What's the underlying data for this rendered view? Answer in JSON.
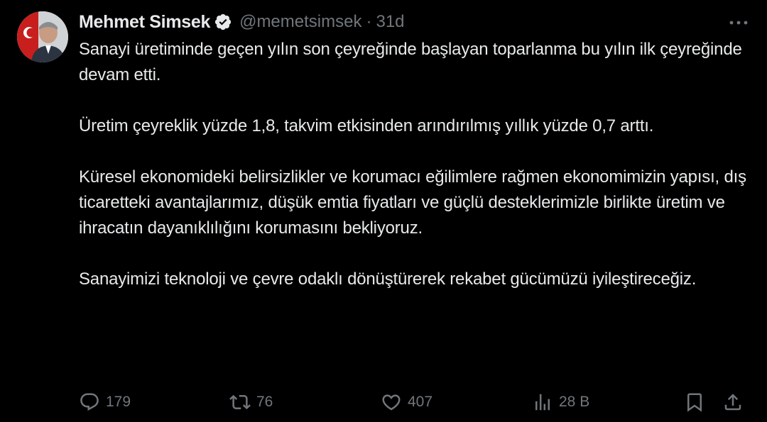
{
  "author": {
    "display_name": "Mehmet Simsek",
    "handle": "@memetsimsek",
    "separator": "·",
    "time": "31d",
    "verified": true
  },
  "body": {
    "paragraphs": [
      "Sanayi üretiminde geçen yılın son çeyreğinde başlayan toparlanma bu yılın ilk çeyreğinde devam etti.",
      "Üretim çeyreklik yüzde 1,8, takvim etkisinden arındırılmış yıllık yüzde 0,7 arttı.",
      "Küresel ekonomideki belirsizlikler ve korumacı eğilimlere rağmen ekonomimizin yapısı, dış ticaretteki avantajlarımız, düşük emtia fiyatları ve güçlü desteklerimizle birlikte üretim ve ihracatın dayanıklılığını korumasını bekliyoruz.",
      "Sanayimizi teknoloji ve çevre odaklı dönüştürerek rekabet gücümüzü iyileştireceğiz."
    ]
  },
  "actions": {
    "replies": "179",
    "reposts": "76",
    "likes": "407",
    "views": "28 B"
  },
  "icons": {
    "more": "more-horizontal-icon",
    "verified": "verified-badge-icon",
    "reply": "reply-icon",
    "repost": "repost-icon",
    "like": "heart-icon",
    "views": "views-icon",
    "bookmark": "bookmark-icon",
    "share": "share-icon"
  },
  "colors": {
    "background": "#000000",
    "text": "#e7e9ea",
    "muted": "#71767b",
    "verified": "#e7e9ea"
  }
}
